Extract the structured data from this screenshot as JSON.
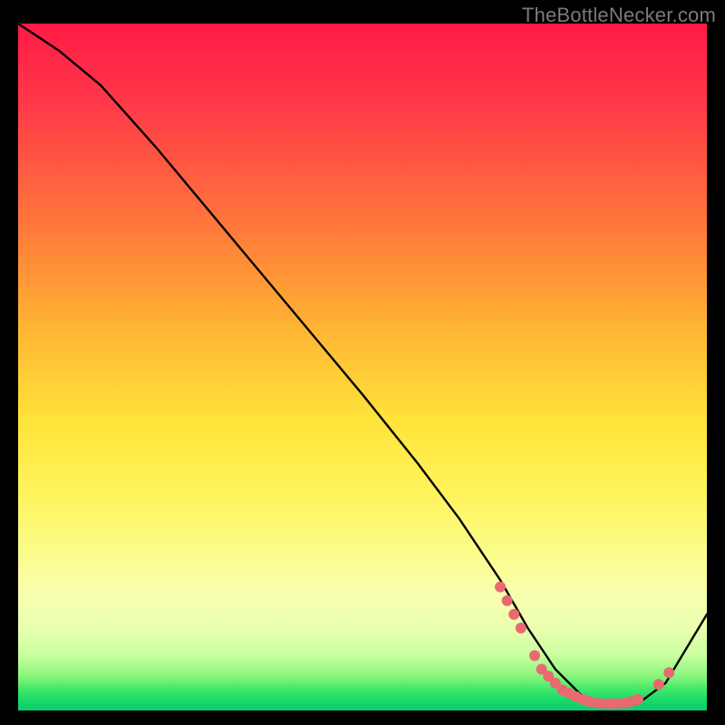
{
  "watermark": "TheBottleNecker.com",
  "chart_data": {
    "type": "line",
    "title": "",
    "xlabel": "",
    "ylabel": "",
    "xlim": [
      0,
      100
    ],
    "ylim": [
      0,
      100
    ],
    "series": [
      {
        "name": "bottleneck-curve",
        "x": [
          0,
          6,
          12,
          20,
          30,
          40,
          50,
          58,
          64,
          70,
          74,
          78,
          82,
          86,
          90,
          94,
          100
        ],
        "y": [
          100,
          96,
          91,
          82,
          70,
          58,
          46,
          36,
          28,
          19,
          12,
          6,
          2,
          1,
          1,
          4,
          14
        ]
      }
    ],
    "highlight_dots": {
      "name": "optimal-region",
      "color": "#e86a6f",
      "points": [
        {
          "x": 70,
          "y": 18
        },
        {
          "x": 71,
          "y": 16
        },
        {
          "x": 72,
          "y": 14
        },
        {
          "x": 73,
          "y": 12
        },
        {
          "x": 75,
          "y": 8
        },
        {
          "x": 76,
          "y": 6
        },
        {
          "x": 77,
          "y": 5
        },
        {
          "x": 78,
          "y": 4
        },
        {
          "x": 79,
          "y": 3
        },
        {
          "x": 80,
          "y": 2.5
        },
        {
          "x": 81,
          "y": 2
        },
        {
          "x": 82,
          "y": 1.6
        },
        {
          "x": 83,
          "y": 1.3
        },
        {
          "x": 84,
          "y": 1.1
        },
        {
          "x": 85,
          "y": 1
        },
        {
          "x": 86,
          "y": 1
        },
        {
          "x": 87,
          "y": 1
        },
        {
          "x": 88,
          "y": 1.1
        },
        {
          "x": 89,
          "y": 1.3
        },
        {
          "x": 90,
          "y": 1.6
        },
        {
          "x": 93,
          "y": 3.8
        },
        {
          "x": 94.5,
          "y": 5.5
        }
      ]
    },
    "gradient_stops": [
      {
        "pos": 0,
        "color": "#ff1a46"
      },
      {
        "pos": 0.45,
        "color": "#ffb733"
      },
      {
        "pos": 0.7,
        "color": "#fff35a"
      },
      {
        "pos": 0.9,
        "color": "#c9ff9e"
      },
      {
        "pos": 1.0,
        "color": "#0bcc6e"
      }
    ]
  }
}
